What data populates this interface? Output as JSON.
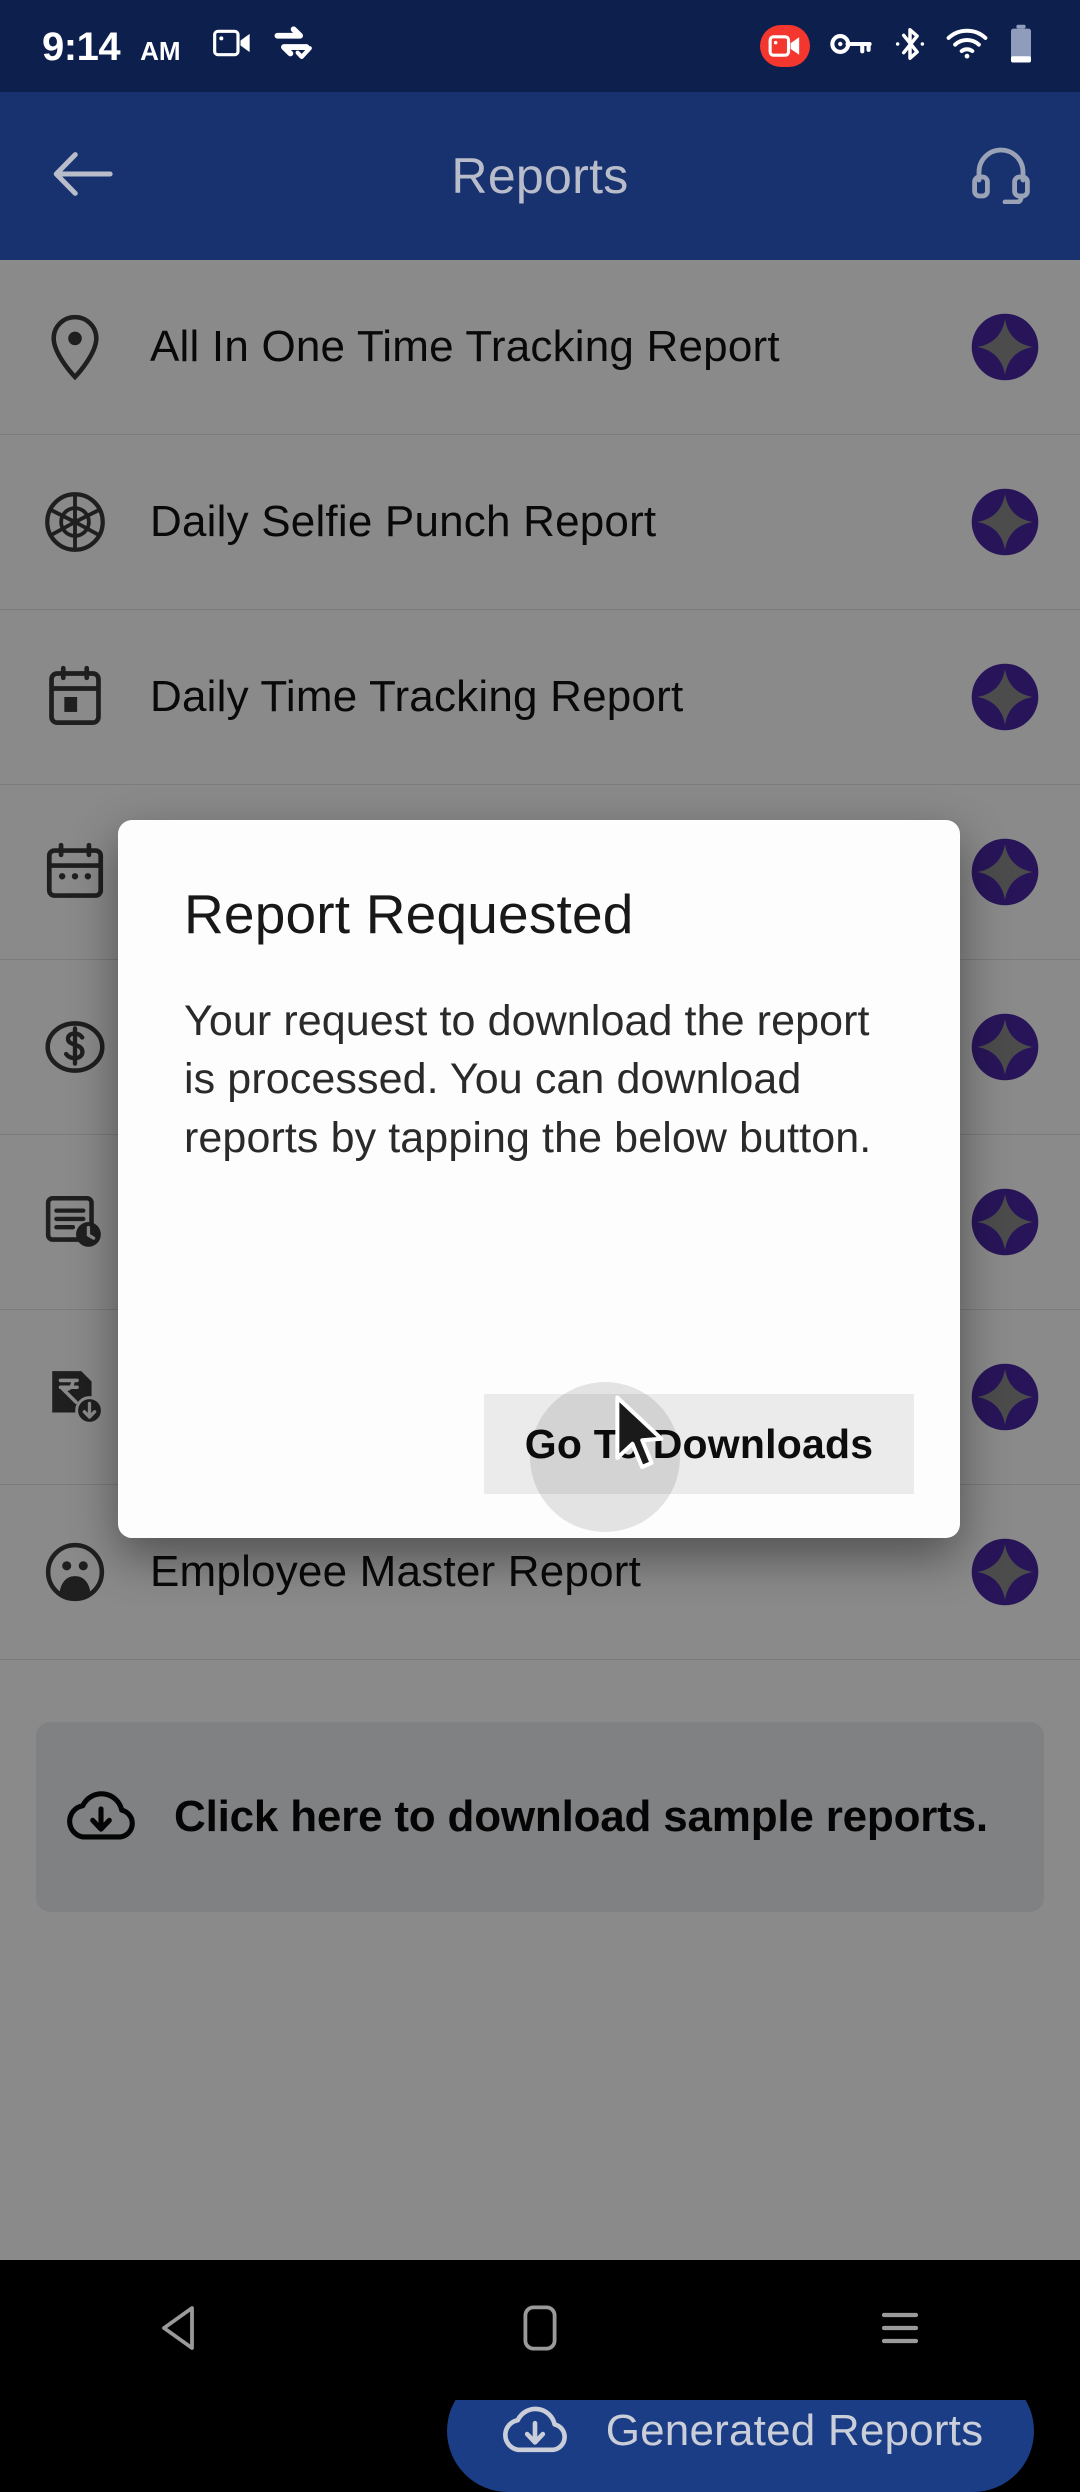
{
  "status_bar": {
    "time": "9:14",
    "ampm": "AM",
    "icons_left": [
      "video-camera-icon",
      "sync-check-icon"
    ],
    "icons_right": [
      "screen-record-badge-icon",
      "vpn-key-icon",
      "bluetooth-icon",
      "wifi-icon",
      "battery-icon"
    ],
    "background_color": "#0d1f4c",
    "record_badge_color": "#f4372e"
  },
  "app_bar": {
    "title": "Reports",
    "back_icon": "arrow-left-icon",
    "support_icon": "headset-icon",
    "background_color": "#183270",
    "title_color": "#b9bdca"
  },
  "reports": {
    "rows": [
      {
        "label": "All In One Time Tracking Report",
        "icon": "location-pin-icon",
        "badge": "sparkle-badge-icon"
      },
      {
        "label": "Daily Selfie Punch Report",
        "icon": "camera-aperture-icon",
        "badge": "sparkle-badge-icon"
      },
      {
        "label": "Daily Time Tracking Report",
        "icon": "calendar-icon",
        "badge": "sparkle-badge-icon"
      },
      {
        "label": "",
        "icon": "calendar-month-icon",
        "badge": "sparkle-badge-icon"
      },
      {
        "label": "",
        "icon": "dollar-circle-icon",
        "badge": "sparkle-badge-icon"
      },
      {
        "label": "",
        "icon": "document-clock-icon",
        "badge": "sparkle-badge-icon"
      },
      {
        "label": "",
        "icon": "rupee-download-icon",
        "badge": "sparkle-badge-icon"
      },
      {
        "label": "Employee Master Report",
        "icon": "employee-icon",
        "badge": "sparkle-badge-icon"
      }
    ],
    "badge_color": "#4b28a4"
  },
  "sample_banner": {
    "text": "Click here to download sample reports.",
    "icon": "cloud-download-icon",
    "background_color": "#edeff3"
  },
  "fab": {
    "label": "Generated Reports",
    "icon": "cloud-download-icon",
    "background_color": "#1b3d86",
    "label_color": "#c9ced9"
  },
  "dialog": {
    "title": "Report Requested",
    "body": "Your request to download the report is processed. You can download reports by tapping the below button.",
    "button_label": "Go To Downloads",
    "background_color": "#fdfdfd",
    "button_background_color": "#ebebeb"
  },
  "nav_bar": {
    "back_icon": "triangle-back-icon",
    "home_icon": "home-rounded-square-icon",
    "recents_icon": "hamburger-recents-icon",
    "background_color": "#000000"
  }
}
